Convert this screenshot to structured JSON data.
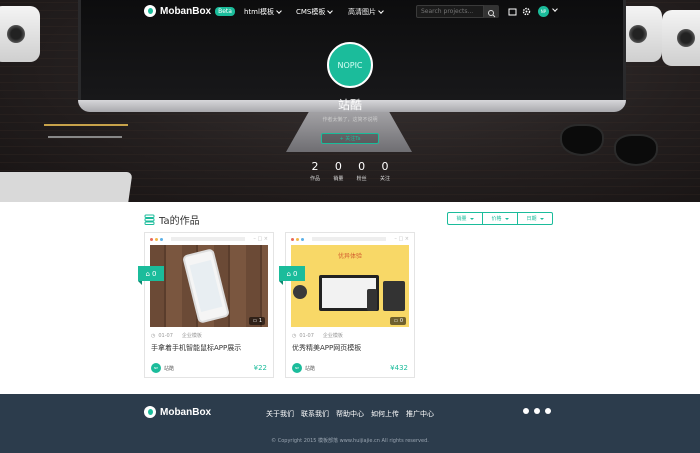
{
  "colors": {
    "accent": "#1bbc9b",
    "footer_bg": "#2c3c4c"
  },
  "nav": {
    "logo_text": "MobanBox",
    "beta_label": "Beta",
    "items": [
      {
        "label": "html模板"
      },
      {
        "label": "CMS模板"
      },
      {
        "label": "高清图片"
      }
    ],
    "search_placeholder": "Search projects...",
    "icons": [
      "search-icon",
      "folder-icon",
      "gear-icon"
    ],
    "avatar_initials": "NP"
  },
  "profile": {
    "avatar_text": "NOPIC",
    "name": "站酷",
    "bio": "作者太懒了，这简不说明",
    "follow_label": "+ 关注Ta",
    "stats": [
      {
        "value": "2",
        "label": "作品"
      },
      {
        "value": "0",
        "label": "销量"
      },
      {
        "value": "0",
        "label": "粉丝"
      },
      {
        "value": "0",
        "label": "关注"
      }
    ]
  },
  "works": {
    "title": "Ta的作品",
    "sort_buttons": [
      "销量",
      "价格",
      "日期"
    ],
    "cards": [
      {
        "likes": "0",
        "comments": "1",
        "date": "01-07",
        "category": "企业模板",
        "title": "手拿着手机智能鼠标APP展示",
        "author": "站酷",
        "author_initials": "NP",
        "price": "¥22"
      },
      {
        "likes": "0",
        "comments": "0",
        "date": "01-07",
        "category": "企业模板",
        "title": "优秀精美APP网页模板",
        "author": "站酷",
        "author_initials": "NP",
        "price": "¥432",
        "thumb_heading": "优异体验"
      }
    ]
  },
  "footer": {
    "logo_text": "MobanBox",
    "links": [
      "关于我们",
      "联系我们",
      "帮助中心",
      "如何上传",
      "推广中心"
    ],
    "social_icons": [
      "wechat-icon",
      "weibo-icon",
      "qq-icon"
    ],
    "copyright": "© Copyright 2015 模板部落 www.huijiajie.cn All rights reserved."
  }
}
